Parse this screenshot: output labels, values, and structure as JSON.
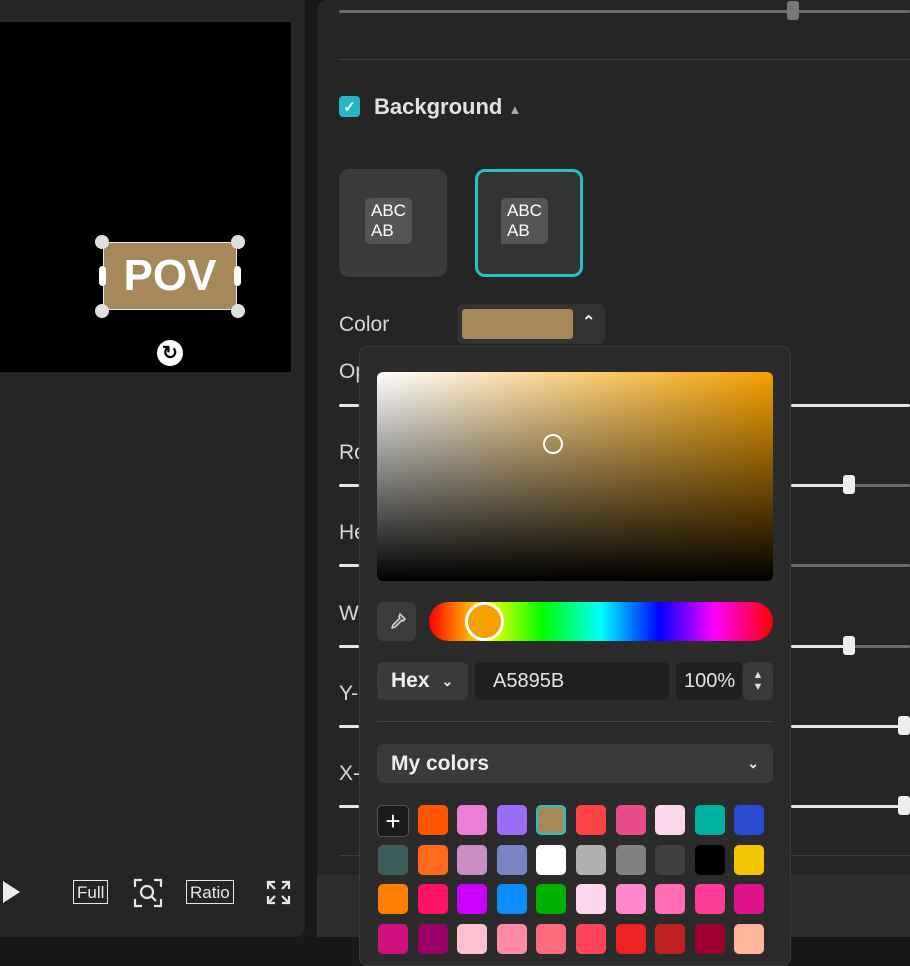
{
  "preview": {
    "text": "POV",
    "box_color": "#a5895b",
    "controls": {
      "full": "Full",
      "ratio": "Ratio"
    }
  },
  "background_section": {
    "checked": true,
    "title": "Background",
    "style_cards": [
      {
        "line1": "ABC",
        "line2": "AB",
        "selected": false
      },
      {
        "line1": "ABC",
        "line2": "AB",
        "selected": true
      }
    ],
    "color_label": "Color",
    "color_value": "#a5895b",
    "partial_labels": [
      "Op",
      "Ro",
      "He",
      "W",
      "Y-",
      "X-"
    ]
  },
  "color_picker": {
    "format": "Hex",
    "hex_value": "A5895B",
    "opacity": "100%",
    "palette_title": "My colors",
    "add_label": "+",
    "swatches": [
      "#ff5500",
      "#ec7fd6",
      "#9b6cf5",
      "#a5895b",
      "#ff4444",
      "#e84b8a",
      "#f8d8ea",
      "#00b1a0",
      "#2a4bcf",
      "#3d5d5a",
      "#ff6a1f",
      "#c98ec2",
      "#7883c2",
      "#ffffff",
      "#b0b0b0",
      "#808080",
      "#404040",
      "#000000",
      "#f5c400",
      "#ff7f00",
      "#ff1166",
      "#cc00ff",
      "#0d8bff",
      "#00b000",
      "#ffd6f0",
      "#ff88cc",
      "#ff6eb3",
      "#ff3d99",
      "#e0148a",
      "#d0107e",
      "#99006a",
      "#ffc0d0",
      "#ff8aa8",
      "#ff6b7e",
      "#ff4459",
      "#ee2222",
      "#c02020",
      "#a00030",
      "#ffb49c"
    ],
    "selected_swatch": "#a5895b"
  }
}
